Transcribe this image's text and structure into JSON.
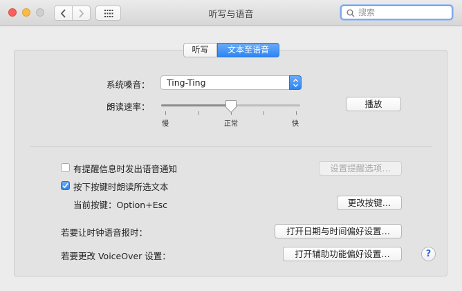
{
  "window": {
    "title": "听写与语音"
  },
  "search": {
    "placeholder": "搜索"
  },
  "tabs": [
    {
      "label": "听写",
      "active": false
    },
    {
      "label": "文本至语音",
      "active": true
    }
  ],
  "voice": {
    "label": "系统嗓音：",
    "value": "Ting-Ting"
  },
  "rate": {
    "label": "朗读速率：",
    "slow": "慢",
    "normal": "正常",
    "fast": "快",
    "level": 0.5
  },
  "play_button": "播放",
  "notify": {
    "label": "有提醒信息时发出语音通知",
    "checked": false,
    "options_button": "设置提醒选项…"
  },
  "speak_selection": {
    "label": "按下按键时朗读所选文本",
    "checked": true,
    "current_key": "当前按键：Option+Esc",
    "change_button": "更改按键…"
  },
  "clock": {
    "label": "若要让时钟语音报时：",
    "button": "打开日期与时间偏好设置…"
  },
  "voiceover": {
    "label": "若要更改 VoiceOver 设置：",
    "button": "打开辅助功能偏好设置…"
  },
  "help": "?",
  "colors": {
    "accent": "#2d86f3",
    "close": "#fc605b",
    "minimize": "#fdbc40"
  }
}
